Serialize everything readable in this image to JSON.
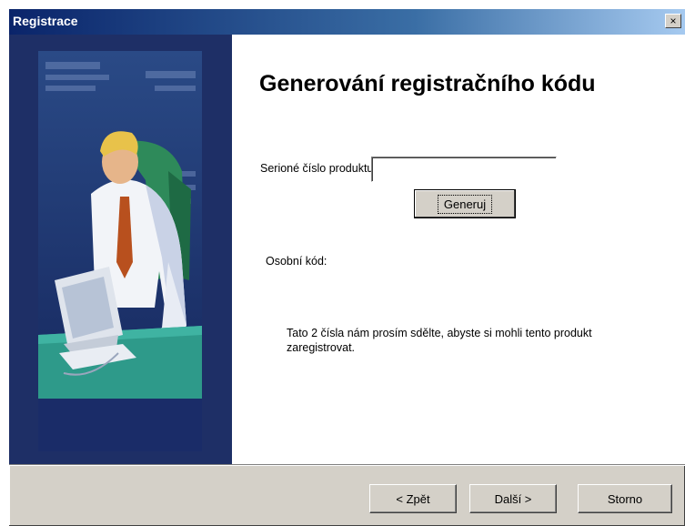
{
  "window": {
    "title": "Registrace",
    "close_label": "×"
  },
  "page": {
    "heading": "Generování registračního kódu",
    "serial_label": "Serioné číslo produktu:",
    "serial_value": "",
    "generate_label": "Generuj",
    "personal_code_label": "Osobní kód:",
    "info_text": "Tato 2 čísla nám prosím sdělte, abyste si mohli tento produkt zaregistrovat."
  },
  "footer": {
    "back_label": "< Zpět",
    "next_label": "Další >",
    "cancel_label": "Storno"
  },
  "colors": {
    "titlebar_start": "#0a246a",
    "titlebar_end": "#a6caf0",
    "dialog_face": "#d4d0c8",
    "sidebar_bg": "#1e2f66"
  },
  "icons": {
    "close": "close-icon",
    "sidebar_art": "user-at-computer-illustration"
  }
}
